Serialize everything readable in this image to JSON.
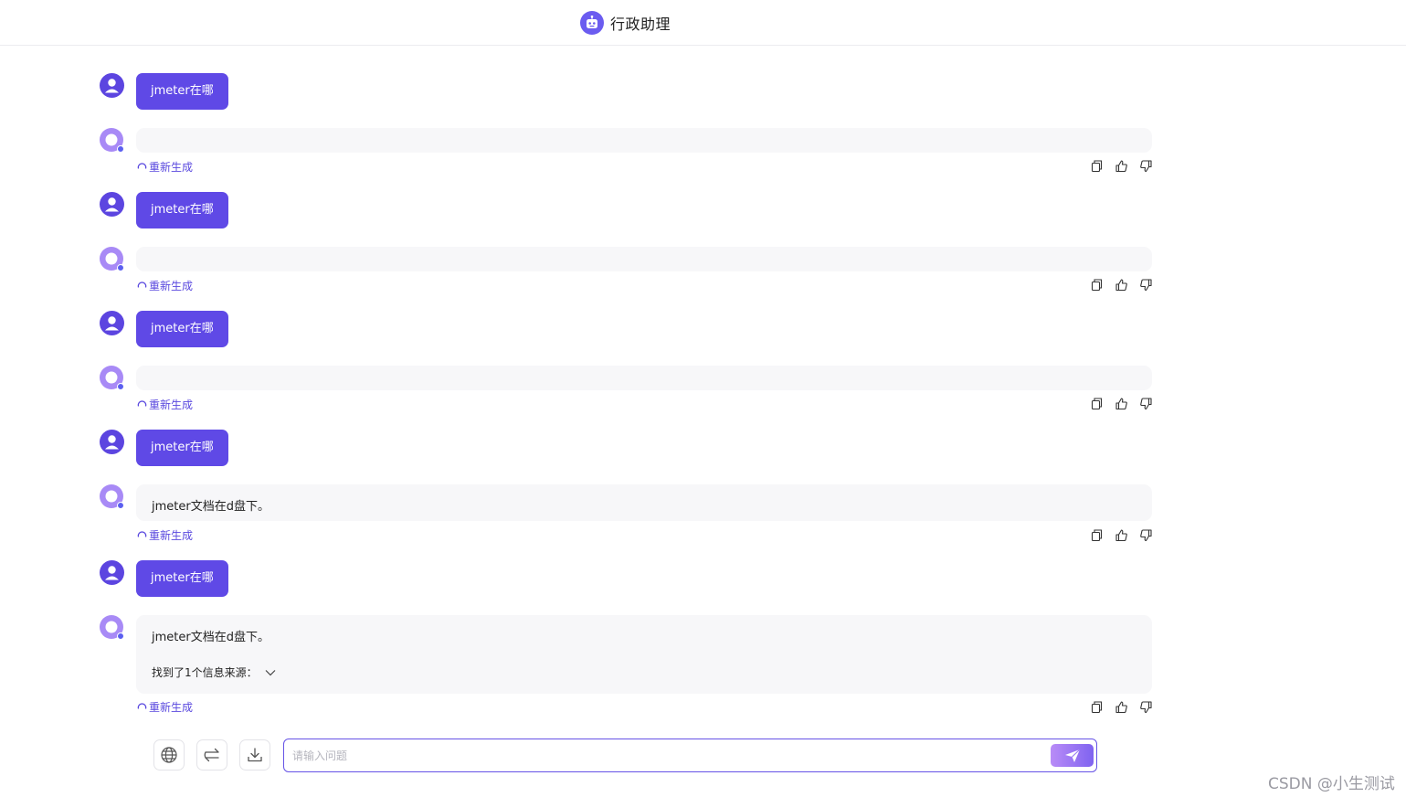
{
  "header": {
    "title": "行政助理",
    "icon": "robot-icon"
  },
  "messages": [
    {
      "user": "jmeter在哪",
      "bot": "",
      "regen": "重新生成"
    },
    {
      "user": "jmeter在哪",
      "bot": "",
      "regen": "重新生成"
    },
    {
      "user": "jmeter在哪",
      "bot": "",
      "regen": "重新生成"
    },
    {
      "user": "jmeter在哪",
      "bot": "jmeter文档在d盘下。",
      "regen": "重新生成"
    },
    {
      "user": "jmeter在哪",
      "bot": "jmeter文档在d盘下。",
      "sources": "找到了1个信息来源：",
      "regen": "重新生成"
    }
  ],
  "input": {
    "placeholder": "请输入问题",
    "value": ""
  },
  "tools": [
    "globe-icon",
    "swap-icon",
    "download-icon"
  ],
  "watermark": "CSDN @小生测试",
  "colors": {
    "accent": "#5f49e6",
    "bot_bubble": "#f7f7f9",
    "regen_text": "#5a49df"
  }
}
